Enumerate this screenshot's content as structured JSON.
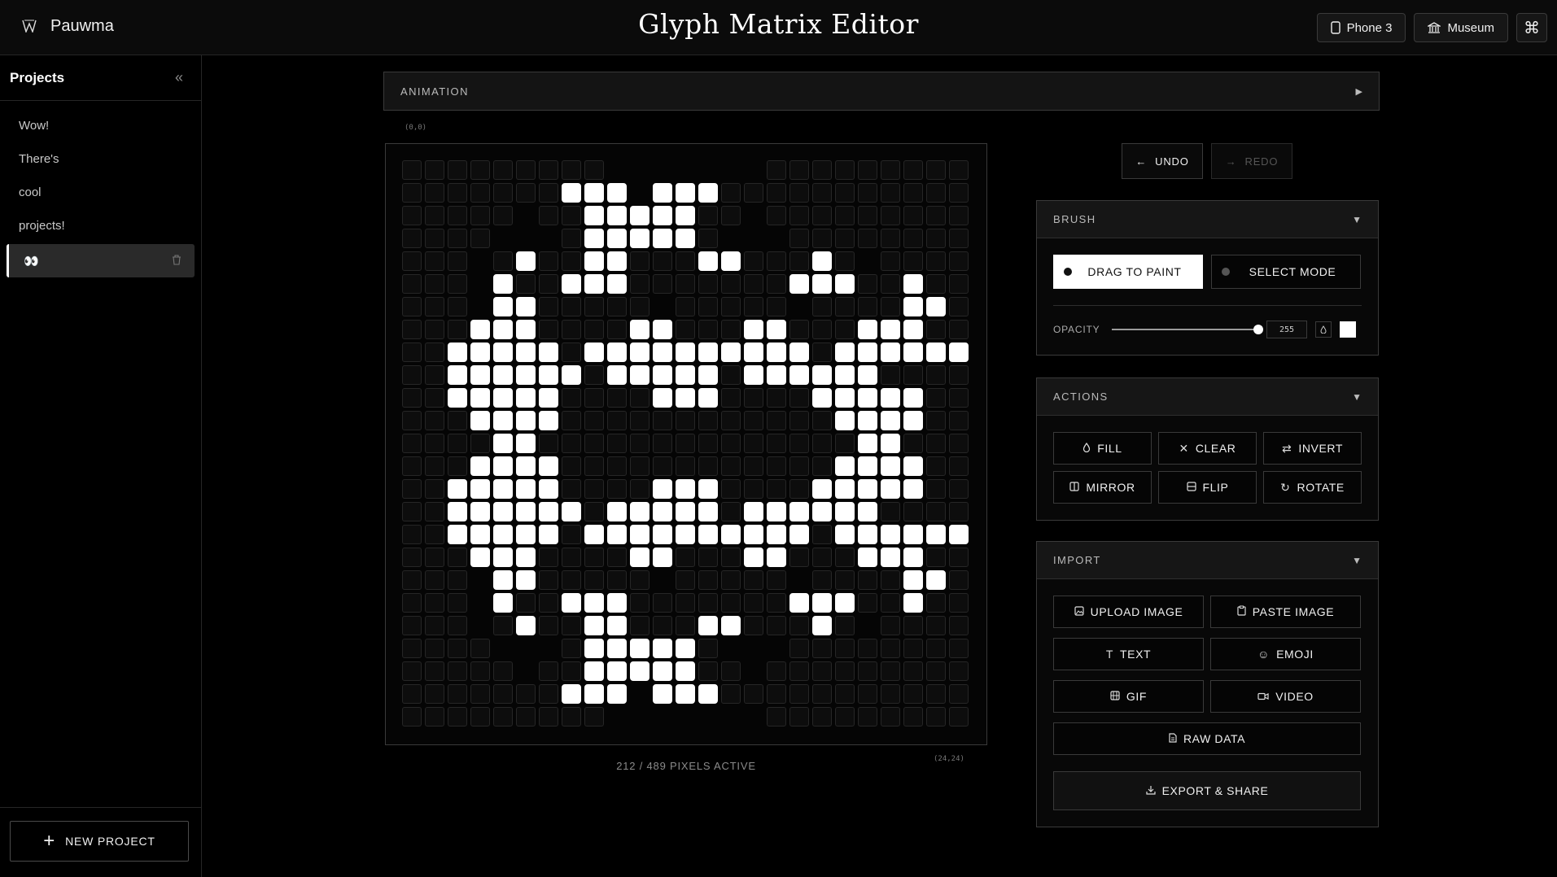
{
  "app": {
    "brand_name": "Pauwma",
    "title": "Glyph Matrix Editor",
    "device_button": "Phone 3",
    "museum_button": "Museum",
    "command_icon": "⌘"
  },
  "sidebar": {
    "title": "Projects",
    "projects": [
      {
        "label": "Wow!"
      },
      {
        "label": "There's"
      },
      {
        "label": "cool"
      },
      {
        "label": "projects!"
      },
      {
        "label": "👀"
      }
    ],
    "new_project": "NEW PROJECT"
  },
  "animation": {
    "label": "ANIMATION",
    "arrow": "▶"
  },
  "canvas": {
    "coord_top_left": "(0,0)",
    "coord_bottom_right": "(24,24)",
    "pixel_count": "212 / 489 PIXELS ACTIVE",
    "rows": [
      ".........ooooooo.........",
      ".......@@@o@@@...........",
      ".....o..@@@@@..o.........",
      "....ooo.@@@@@.ooo........",
      "...o.@..@@...@@...@.o....",
      "...o@..@@@.......@@@..@...",
      "...o@@.....o.....o....@@...",
      "...@@@....@@...@@...@@@..",
      "..@@@@@.@@@@@@@@@@.@@@@@@.",
      "..@@@@@@.@@@@@.@@@@@@.....",
      "..@@@@@....@@@....@@@@@...",
      "...@@@@............@@@@...",
      "....@@..............@@....",
      "...@@@@............@@@@...",
      "..@@@@@....@@@....@@@@@...",
      "..@@@@@@.@@@@@.@@@@@@.....",
      "..@@@@@.@@@@@@@@@@.@@@@@@.",
      "...@@@....@@...@@...@@@..",
      "...o@@.....o.....o....@@...",
      "...o@..@@@.......@@@..@...",
      "...o.@..@@...@@...@.o....",
      "....ooo.@@@@@.ooo........",
      ".....o..@@@@@..o.........",
      ".......@@@o@@@...........",
      ".........ooooooo........."
    ]
  },
  "history": {
    "undo": "UNDO",
    "redo": "REDO"
  },
  "brush": {
    "title": "BRUSH",
    "chevron": "▼",
    "drag_to_paint": "DRAG TO PAINT",
    "select_mode": "SELECT MODE",
    "opacity_label": "OPACITY",
    "opacity_value": "255",
    "opacity_fraction": 1.0,
    "color": "#ffffff"
  },
  "actions": {
    "title": "ACTIONS",
    "chevron": "▼",
    "fill": "FILL",
    "clear": "CLEAR",
    "invert": "INVERT",
    "mirror": "MIRROR",
    "flip": "FLIP",
    "rotate": "ROTATE"
  },
  "import": {
    "title": "IMPORT",
    "chevron": "▼",
    "upload_image": "UPLOAD IMAGE",
    "paste_image": "PASTE IMAGE",
    "text": "TEXT",
    "emoji": "EMOJI",
    "gif": "GIF",
    "video": "VIDEO",
    "raw_data": "RAW DATA",
    "export_share": "EXPORT & SHARE"
  },
  "colors": {
    "background": "#000000",
    "pixel_on": "#ffffff",
    "pixel_off": "#0d0d0d",
    "border": "#3a3a3a"
  }
}
